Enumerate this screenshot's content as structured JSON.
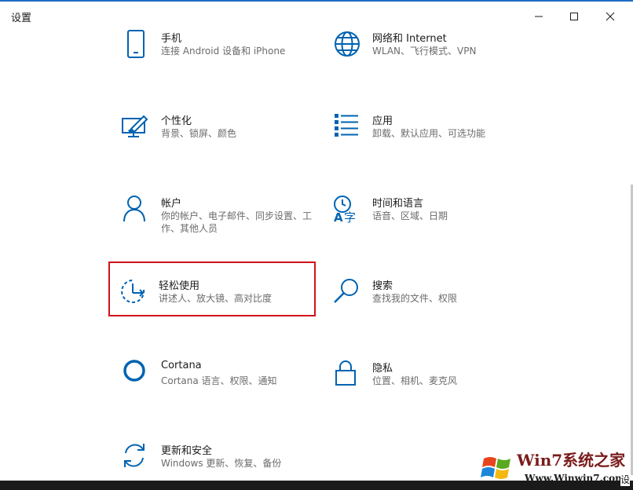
{
  "window": {
    "title": "设置",
    "controls": [
      "minimize-icon",
      "maximize-icon",
      "close-icon"
    ]
  },
  "tiles": [
    {
      "icon": "phone-icon",
      "title": "手机",
      "desc": "连接 Android 设备和 iPhone"
    },
    {
      "icon": "globe-icon",
      "title": "网络和 Internet",
      "desc": "WLAN、飞行模式、VPN"
    },
    {
      "icon": "paintbrush-screen-icon",
      "title": "个性化",
      "desc": "背景、锁屏、颜色"
    },
    {
      "icon": "app-list-icon",
      "title": "应用",
      "desc": "卸载、默认应用、可选功能"
    },
    {
      "icon": "person-icon",
      "title": "帐户",
      "desc": "你的帐户、电子邮件、同步设置、工作、其他人员"
    },
    {
      "icon": "time-language-icon",
      "title": "时间和语言",
      "desc": "语音、区域、日期"
    },
    {
      "icon": "ease-of-access-icon",
      "title": "轻松使用",
      "desc": "讲述人、放大镜、高对比度"
    },
    {
      "icon": "search-icon",
      "title": "搜索",
      "desc": "查找我的文件、权限"
    },
    {
      "icon": "cortana-icon",
      "title": "Cortana",
      "desc": "Cortana 语言、权限、通知"
    },
    {
      "icon": "lock-icon",
      "title": "隐私",
      "desc": "位置、相机、麦克风"
    },
    {
      "icon": "sync-arrows-icon",
      "title": "更新和安全",
      "desc": "Windows 更新、恢复、备份"
    }
  ],
  "watermark": {
    "brand": "Win7系统之家",
    "url": "Www.Winwin7.com",
    "tail": "设"
  },
  "colors": {
    "accent": "#0063b1",
    "highlight": "#d0121b",
    "title_bar_line": "#1f6fc5"
  }
}
